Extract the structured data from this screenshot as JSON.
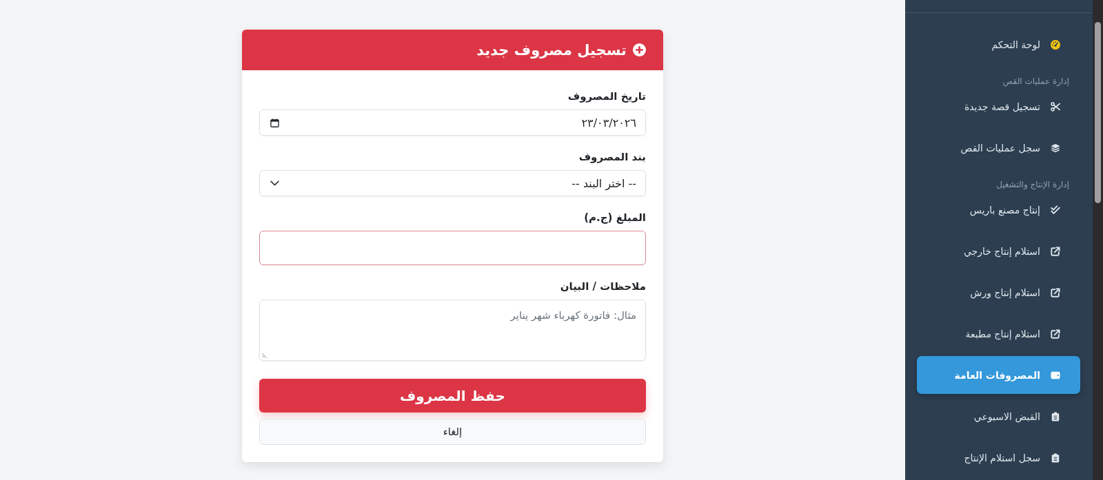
{
  "sidebar": {
    "items": [
      {
        "kind": "link",
        "label": "لوحة التحكم",
        "selected": false
      },
      {
        "kind": "section",
        "label": "إدارة عمليات القص"
      },
      {
        "kind": "link",
        "label": "تسجيل قصة جديدة",
        "selected": false
      },
      {
        "kind": "link",
        "label": "سجل عمليات القص",
        "selected": false
      },
      {
        "kind": "section",
        "label": "إدارة الإنتاج والتشغيل"
      },
      {
        "kind": "link",
        "label": "إنتاج مصنع باريس",
        "selected": false
      },
      {
        "kind": "link",
        "label": "استلام إنتاج خارجي",
        "selected": false
      },
      {
        "kind": "link",
        "label": "استلام إنتاج ورش",
        "selected": false
      },
      {
        "kind": "link",
        "label": "استلام إنتاج مطبعة",
        "selected": false
      },
      {
        "kind": "link",
        "label": "المصروفات العامة",
        "selected": true
      },
      {
        "kind": "link",
        "label": "القبض الاسبوعي",
        "selected": false
      },
      {
        "kind": "link",
        "label": "سجل استلام الإنتاج",
        "selected": false
      }
    ]
  },
  "form": {
    "title": "تسجيل مصروف جديد",
    "fields": [
      {
        "kind": "date",
        "label": "تاريخ المصروف",
        "value": "٢٣/٠٣/٢٠٢٦"
      },
      {
        "kind": "select",
        "label": "بند المصروف",
        "value": "-- اختر البند --"
      },
      {
        "kind": "text",
        "label": "المبلغ (ج.م)",
        "invalid": true
      },
      {
        "kind": "textarea",
        "label": "ملاحظات / البيان",
        "placeholder": "مثال: فاتورة كهرباء شهر يناير"
      }
    ],
    "buttons": [
      {
        "kind": "primary",
        "label": "حفظ المصروف"
      },
      {
        "kind": "secondary",
        "label": "إلغاء"
      }
    ]
  }
}
